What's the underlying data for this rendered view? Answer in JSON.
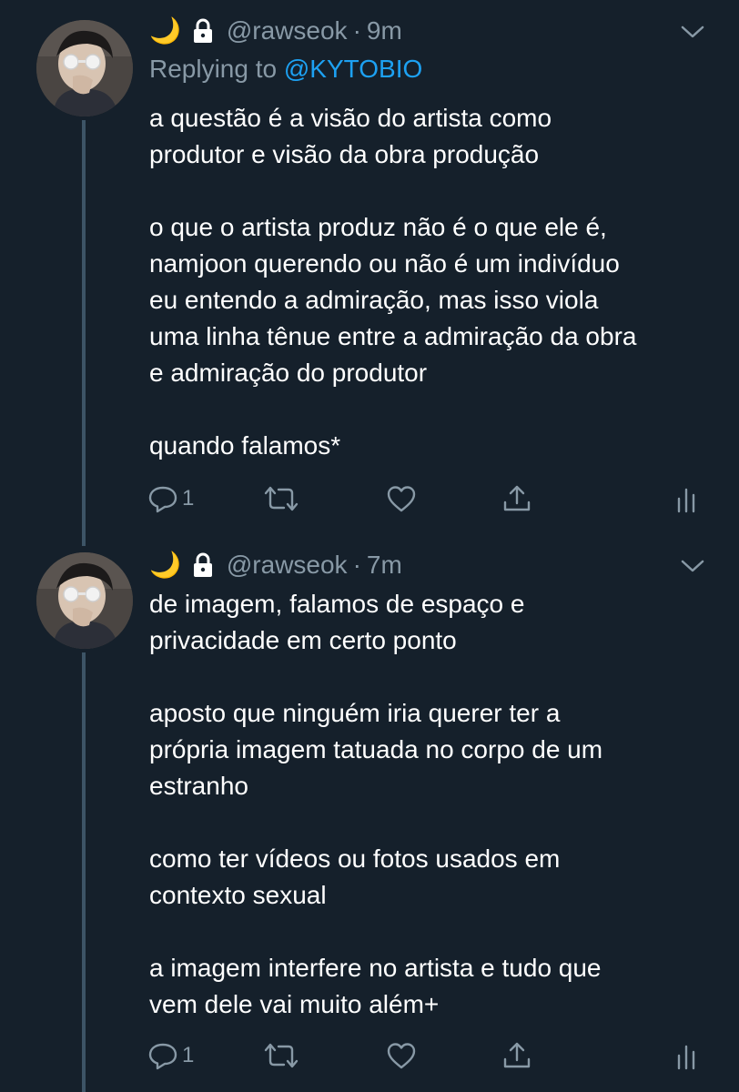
{
  "tweets": [
    {
      "display_name_emoji": "🌙",
      "handle": "@rawseok",
      "separator": "·",
      "time": "9m",
      "replying_prefix": "Replying to",
      "replying_to": "@KYTOBIO",
      "paragraphs": [
        [
          "a questão é a visão do artista como",
          "produtor e visão da obra produção"
        ],
        [
          "o que o artista produz não é o que ele é,",
          "namjoon querendo ou não é um indivíduo",
          "eu entendo a admiração, mas isso viola",
          "uma linha tênue entre a admiração da obra",
          "e admiração do produtor"
        ],
        [
          "quando falamos*"
        ]
      ],
      "reply_count": "1",
      "icons": [
        "moon-emoji",
        "lock-icon",
        "chevron-down-icon",
        "reply-icon",
        "retweet-icon",
        "like-icon",
        "share-icon",
        "analytics-icon"
      ]
    },
    {
      "display_name_emoji": "🌙",
      "handle": "@rawseok",
      "separator": "·",
      "time": "7m",
      "paragraphs": [
        [
          "de imagem, falamos de espaço e",
          "privacidade em certo ponto"
        ],
        [
          "aposto que ninguém iria querer ter a",
          "própria imagem tatuada no corpo de um",
          "estranho"
        ],
        [
          "como ter vídeos ou fotos usados em",
          "contexto sexual"
        ],
        [
          "a imagem interfere no artista e tudo que",
          "vem dele vai muito além+"
        ]
      ],
      "reply_count": "1",
      "icons": [
        "moon-emoji",
        "lock-icon",
        "chevron-down-icon",
        "reply-icon",
        "retweet-icon",
        "like-icon",
        "share-icon",
        "analytics-icon"
      ]
    }
  ],
  "colors": {
    "background": "#15202b",
    "text": "#ffffff",
    "secondary": "#8899a6",
    "accent": "#1da1f2",
    "thread_line": "#3d5466"
  }
}
